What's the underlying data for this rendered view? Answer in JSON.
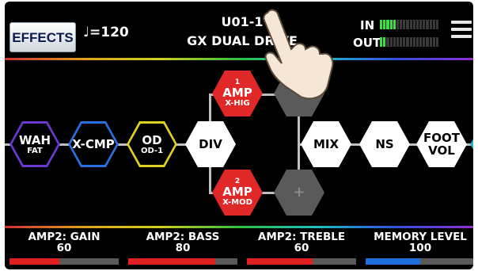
{
  "header": {
    "effects_label": "EFFECTS",
    "tempo_text": "♩=120",
    "patch_number": "U01-1",
    "patch_name": "GX DUAL DRIVE",
    "in_label": "IN",
    "out_label": "OUT",
    "in_level": 0.3,
    "out_level": 0.1,
    "menu_icon": "hamburger-menu-icon"
  },
  "chain": {
    "blocks": [
      {
        "id": "wah",
        "label": "WAH",
        "sub": "FAT",
        "color": "#6a3ad0"
      },
      {
        "id": "xcmp",
        "label": "X-CMP",
        "sub": "",
        "color": "#2a6fe0"
      },
      {
        "id": "od",
        "label": "OD",
        "sub": "OD-1",
        "color": "#e0d020"
      },
      {
        "id": "div",
        "label": "DIV",
        "sub": ""
      },
      {
        "id": "amp1",
        "num": "1",
        "label": "AMP",
        "sub": "X-HIG",
        "color": "#e02828"
      },
      {
        "id": "amp2",
        "num": "2",
        "label": "AMP",
        "sub": "X-MOD",
        "color": "#e02828"
      },
      {
        "id": "add",
        "label": "+",
        "sub": ""
      },
      {
        "id": "mix",
        "label": "MIX",
        "sub": ""
      },
      {
        "id": "ns",
        "label": "NS",
        "sub": ""
      },
      {
        "id": "footvol",
        "label": "FOOT",
        "sub": "VOL"
      }
    ]
  },
  "params": [
    {
      "label": "AMP2: GAIN",
      "value": "60",
      "level": 0.46,
      "color": "#e02020"
    },
    {
      "label": "AMP2: BASS",
      "value": "80",
      "level": 0.8,
      "color": "#e02020"
    },
    {
      "label": "AMP2: TREBLE",
      "value": "60",
      "level": 0.6,
      "color": "#e02020"
    },
    {
      "label": "MEMORY LEVEL",
      "value": "100",
      "level": 0.5,
      "color": "#1e6ee0"
    }
  ]
}
